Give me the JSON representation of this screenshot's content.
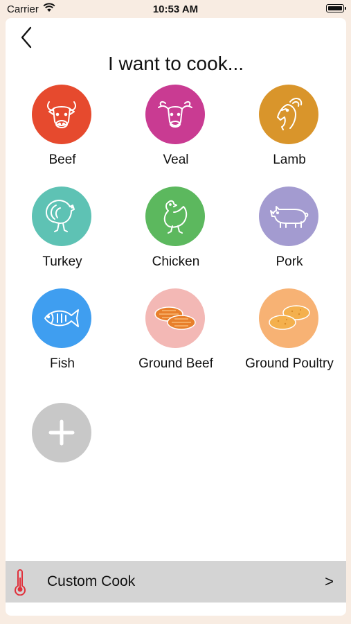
{
  "status": {
    "carrier": "Carrier",
    "time": "10:53 AM"
  },
  "page": {
    "title": "I want to cook..."
  },
  "items": [
    {
      "label": "Beef",
      "color": "#e64a2e",
      "icon": "cow-icon"
    },
    {
      "label": "Veal",
      "color": "#c93b92",
      "icon": "calf-icon"
    },
    {
      "label": "Lamb",
      "color": "#d9952b",
      "icon": "goat-icon"
    },
    {
      "label": "Turkey",
      "color": "#5ec2b4",
      "icon": "turkey-icon"
    },
    {
      "label": "Chicken",
      "color": "#5cb85e",
      "icon": "chicken-icon"
    },
    {
      "label": "Pork",
      "color": "#a39bd0",
      "icon": "pig-icon"
    },
    {
      "label": "Fish",
      "color": "#3f9ef0",
      "icon": "fish-icon"
    },
    {
      "label": "Ground Beef",
      "color": "#f3b8b5",
      "icon": "patties-icon"
    },
    {
      "label": "Ground Poultry",
      "color": "#f7b274",
      "icon": "poultry-patties-icon"
    }
  ],
  "add": {
    "color": "#c8c8c8",
    "icon": "plus-icon"
  },
  "custom": {
    "label": "Custom Cook",
    "chevron": ">",
    "icon": "thermometer-icon"
  }
}
